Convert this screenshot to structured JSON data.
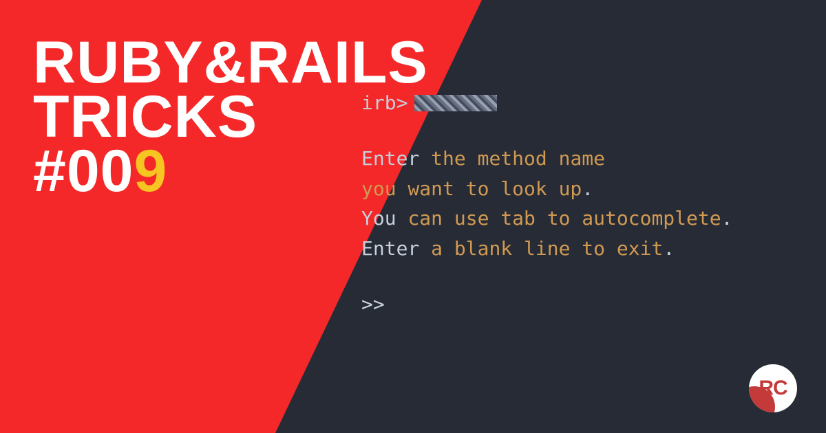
{
  "title": {
    "line1": "RUBY&RAILS",
    "line2": "TRICKS",
    "hash": "#",
    "num_white": "00",
    "num_yellow": "9"
  },
  "terminal": {
    "prompt": "irb>",
    "lines": [
      {
        "plain": "Enter ",
        "hl": "the method name"
      },
      {
        "plain": " ",
        "hl": "you want to look up",
        "tail": "."
      },
      {
        "plain": "You ",
        "hl": "can use tab to autocomplete",
        "tail": "."
      },
      {
        "plain": "Enter ",
        "hl": "a blank line to exit",
        "tail": "."
      }
    ],
    "secondary_prompt": ">>"
  },
  "logo": {
    "text": "RC"
  }
}
